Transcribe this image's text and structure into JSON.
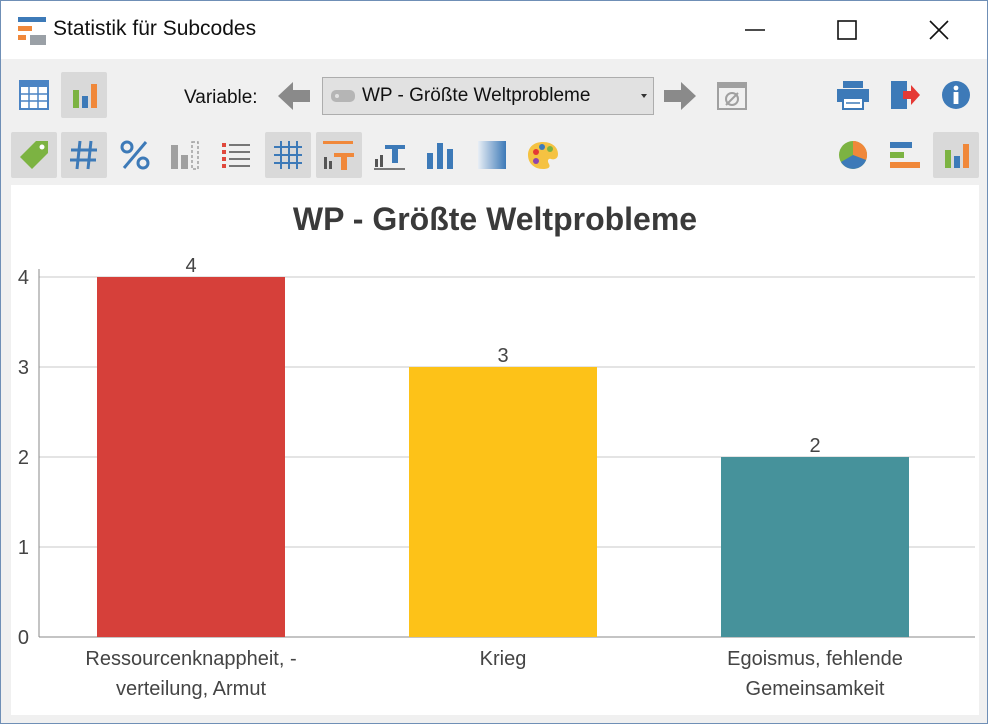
{
  "window": {
    "title": "Statistik für Subcodes",
    "buttons": {
      "minimize": "minimize-icon",
      "maximize": "maximize-icon",
      "close": "close-icon"
    }
  },
  "toolbar": {
    "variable_label": "Variable:",
    "variable_value": "WP - Größte Weltprobleme",
    "view_buttons": [
      {
        "name": "table-view",
        "icon": "table-icon",
        "active": false
      },
      {
        "name": "chart-view",
        "icon": "bar-chart-icon",
        "active": true
      }
    ],
    "right_buttons": [
      "printer-icon",
      "export-icon",
      "info-icon"
    ],
    "format_buttons": [
      {
        "icon": "tag-icon",
        "active": true
      },
      {
        "icon": "hash-icon",
        "active": true
      },
      {
        "icon": "percent-icon",
        "active": false
      },
      {
        "icon": "missing-bars-icon",
        "active": false
      },
      {
        "icon": "list-icon",
        "active": false
      },
      {
        "icon": "grid-icon",
        "active": true
      },
      {
        "icon": "chart-title-icon",
        "active": true
      },
      {
        "icon": "axis-title-icon",
        "active": false
      },
      {
        "icon": "column-chart-icon",
        "active": false
      },
      {
        "icon": "gradient-icon",
        "active": false
      },
      {
        "icon": "palette-icon",
        "active": false
      }
    ],
    "chart_type_buttons": [
      {
        "icon": "pie-chart-icon",
        "active": false
      },
      {
        "icon": "horizontal-bar-icon",
        "active": false
      },
      {
        "icon": "vertical-bar-icon",
        "active": true
      }
    ]
  },
  "colors": {
    "bar1": "#d6403a",
    "bar2": "#fdc218",
    "bar3": "#46929b",
    "icon_blue": "#3d7ab8",
    "icon_orange": "#f0883a"
  },
  "chart_data": {
    "type": "bar",
    "title": "WP - Größte Weltprobleme",
    "categories": [
      [
        "Ressourcenknappheit, -",
        "verteilung, Armut"
      ],
      [
        "Krieg"
      ],
      [
        "Egoismus, fehlende",
        "Gemeinsamkeit"
      ]
    ],
    "values": [
      4,
      3,
      2
    ],
    "data_labels": [
      "4",
      "3",
      "2"
    ],
    "ylim": [
      0,
      4
    ],
    "yticks": [
      0,
      1,
      2,
      3,
      4
    ],
    "grid": true,
    "legend": false
  }
}
